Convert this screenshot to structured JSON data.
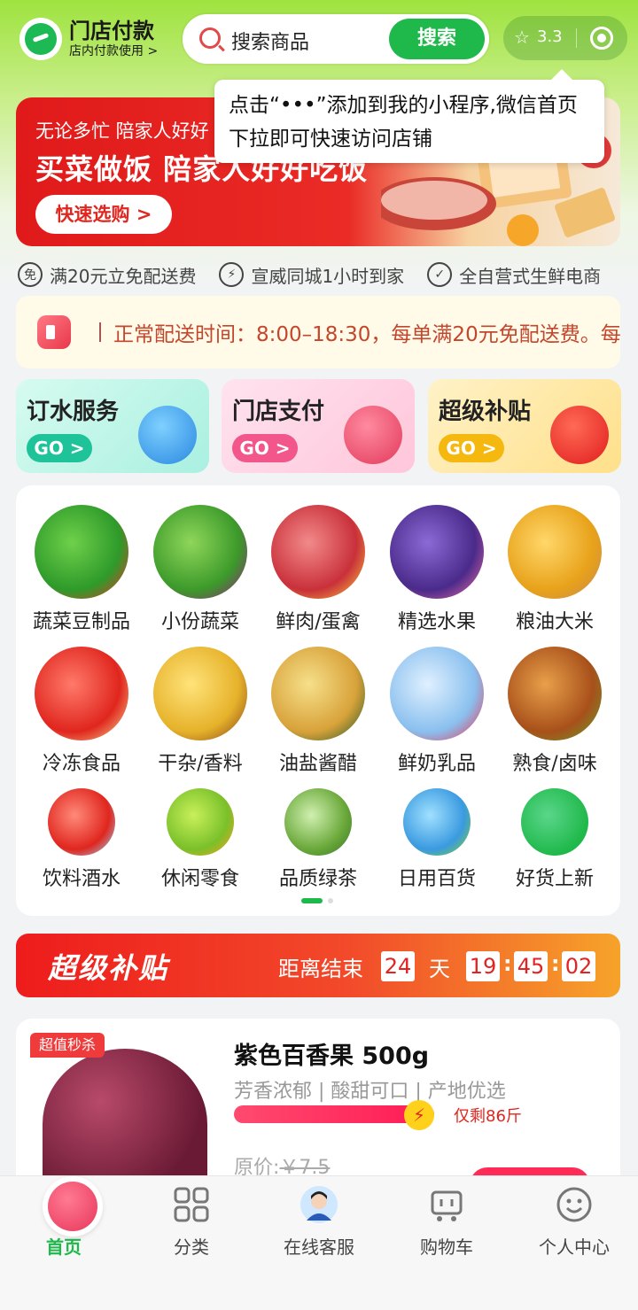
{
  "header": {
    "store_title": "门店付款",
    "store_subtitle": "店内付款使用 >",
    "search_placeholder": "搜索商品",
    "search_button": "搜索",
    "rating": "3.3"
  },
  "tooltip": {
    "text": "点击“•••”添加到我的小程序,微信首页下拉即可快速访问店铺"
  },
  "banner": {
    "line1": "无论多忙 陪家人好好",
    "line2": "买菜做饭 陪家人好好吃饭",
    "button": "快速选购 >"
  },
  "features": [
    {
      "icon": "free-shipping-icon",
      "text": "满20元立免配送费"
    },
    {
      "icon": "lightning-icon",
      "text": "宣威同城1小时到家"
    },
    {
      "icon": "check-circle-icon",
      "text": "全自营式生鲜电商"
    }
  ],
  "notice": {
    "text": "正常配送时间：8:00–18:30，每单满20元免配送费。每"
  },
  "quick_cards": [
    {
      "title": "订水服务",
      "go": "GO >"
    },
    {
      "title": "门店支付",
      "go": "GO >"
    },
    {
      "title": "超级补贴",
      "go": "GO >"
    }
  ],
  "categories": [
    {
      "label": "蔬菜豆制品"
    },
    {
      "label": "小份蔬菜"
    },
    {
      "label": "鲜肉/蛋禽"
    },
    {
      "label": "精选水果"
    },
    {
      "label": "粮油大米"
    },
    {
      "label": "冷冻食品"
    },
    {
      "label": "干杂/香料"
    },
    {
      "label": "油盐酱醋"
    },
    {
      "label": "鲜奶乳品"
    },
    {
      "label": "熟食/卤味"
    },
    {
      "label": "饮料酒水"
    },
    {
      "label": "休闲零食"
    },
    {
      "label": "品质绿茶"
    },
    {
      "label": "日用百货"
    },
    {
      "label": "好货上新"
    }
  ],
  "subsidy": {
    "title": "超级补贴",
    "countdown_label": "距离结束",
    "days": "24",
    "days_unit": "天",
    "hours": "19",
    "minutes": "45",
    "seconds": "02"
  },
  "product": {
    "badge": "超值秒杀",
    "name": "紫色百香果 500g",
    "desc": "芳香浓郁 | 酸甜可口 | 产地优选",
    "remaining": "仅剩86斤",
    "orig_label": "原价:",
    "orig_price": "￥7.5"
  },
  "tabbar": [
    {
      "label": "首页",
      "active": true
    },
    {
      "label": "分类"
    },
    {
      "label": "在线客服"
    },
    {
      "label": "购物车"
    },
    {
      "label": "个人中心"
    }
  ],
  "colors": {
    "accent": "#1fb84a",
    "red": "#e0261e"
  }
}
